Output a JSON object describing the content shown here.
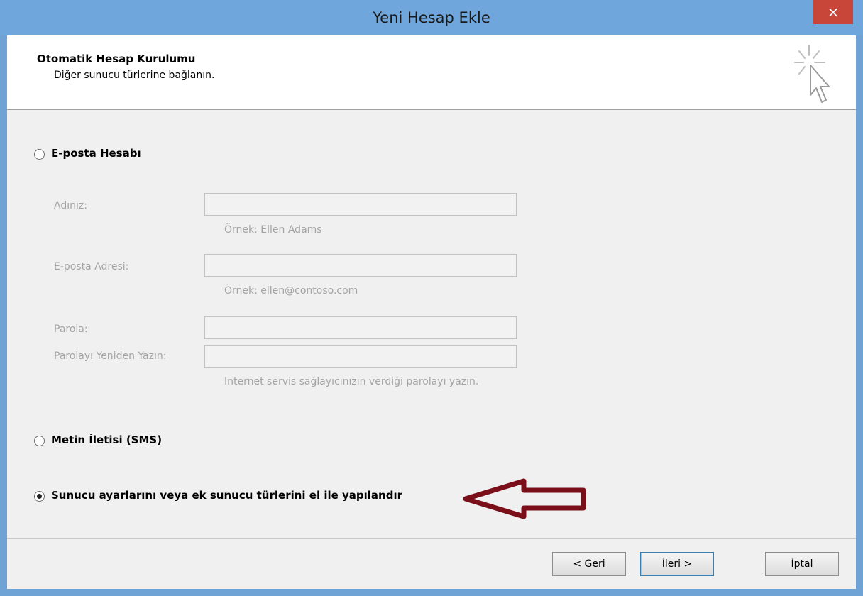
{
  "window": {
    "title": "Yeni Hesap Ekle",
    "close_label": "×"
  },
  "header": {
    "title": "Otomatik Hesap Kurulumu",
    "subtitle": "Diğer sunucu türlerine bağlanın."
  },
  "options": {
    "email_account": {
      "label": "E-posta Hesabı",
      "selected": false
    },
    "sms": {
      "label": "Metin İletisi (SMS)",
      "selected": false
    },
    "manual": {
      "label": "Sunucu ayarlarını veya ek sunucu türlerini el ile yapılandır",
      "selected": true
    }
  },
  "form": {
    "name_label": "Adınız:",
    "name_hint": "Örnek: Ellen Adams",
    "email_label": "E-posta Adresi:",
    "email_hint": "Örnek: ellen@contoso.com",
    "password_label": "Parola:",
    "retype_label": "Parolayı Yeniden Yazın:",
    "password_hint": "Internet servis sağlayıcınızın verdiği parolayı yazın."
  },
  "buttons": {
    "back": "< Geri",
    "next": "İleri >",
    "cancel": "İptal"
  },
  "colors": {
    "titlebar": "#6fa6dc",
    "close": "#c8453a",
    "annotation_arrow": "#7a0f1a"
  },
  "icons": {
    "wizard": "wizard-cursor-icon",
    "arrow": "left-arrow-annotation-icon"
  }
}
